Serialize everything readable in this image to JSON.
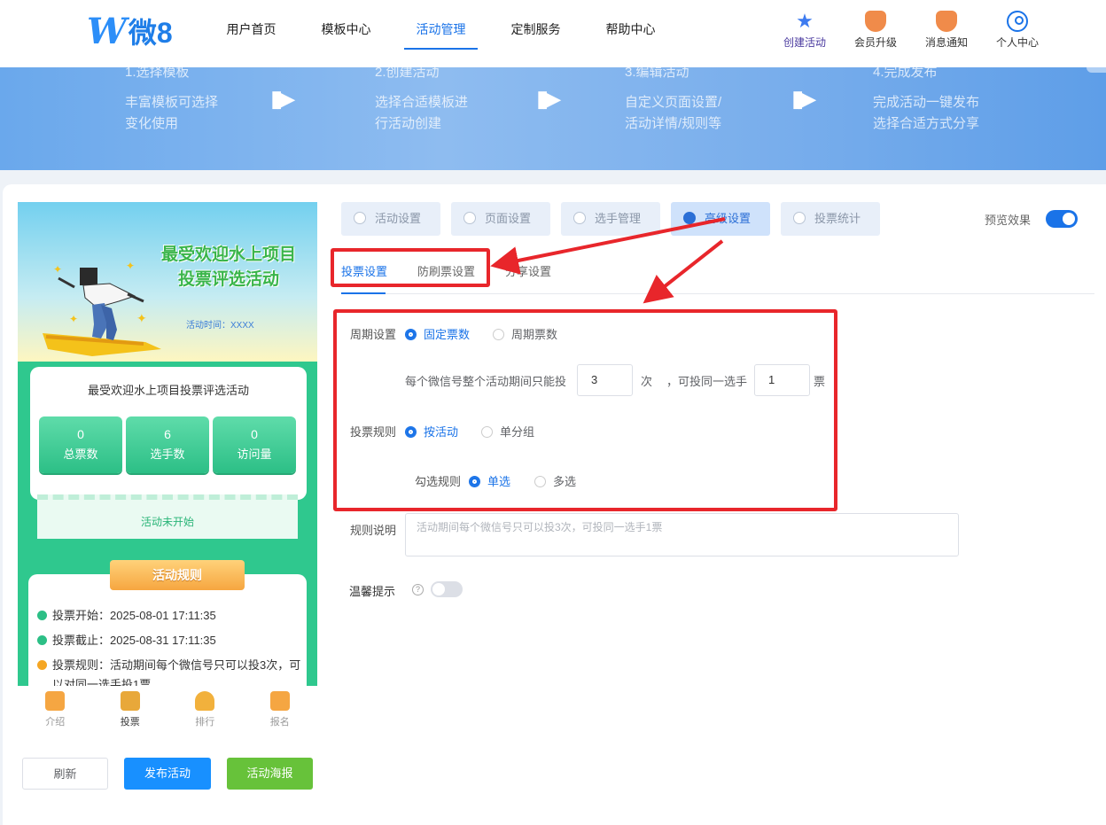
{
  "header": {
    "logo_text": "微8",
    "nav": [
      "用户首页",
      "模板中心",
      "活动管理",
      "定制服务",
      "帮助中心"
    ],
    "active_nav": 2,
    "actions": [
      {
        "label": "创建活动",
        "icon": "star-icon"
      },
      {
        "label": "会员升级",
        "icon": "crown-icon"
      },
      {
        "label": "消息通知",
        "icon": "bell-icon"
      },
      {
        "label": "个人中心",
        "icon": "user-icon"
      }
    ]
  },
  "steps": [
    {
      "title": "1.选择模板",
      "line1": "丰富模板可选择",
      "line2": "变化使用"
    },
    {
      "title": "2.创建活动",
      "line1": "选择合适模板进",
      "line2": "行活动创建"
    },
    {
      "title": "3.编辑活动",
      "line1": "自定义页面设置/",
      "line2": "活动详情/规则等"
    },
    {
      "title": "4.完成发布",
      "line1": "完成活动一键发布",
      "line2": "选择合适方式分享"
    }
  ],
  "preview": {
    "title_line1": "最受欢迎水上项目",
    "title_line2": "投票评选活动",
    "time_label": "活动时间：XXXX",
    "card_title": "最受欢迎水上项目投票评选活动",
    "stats": [
      {
        "value": "0",
        "label": "总票数"
      },
      {
        "value": "6",
        "label": "选手数"
      },
      {
        "value": "0",
        "label": "访问量"
      }
    ],
    "status": "活动未开始",
    "rules_title": "活动规则",
    "rule_start": "投票开始：2025-08-01 17:11:35",
    "rule_end": "投票截止：2025-08-31 17:11:35",
    "rule_text_1": "投票规则：活动期间每个微信号只可以投3次，可",
    "rule_text_2": "以对同一选手投1票",
    "bottom_nav": [
      "介绍",
      "投票",
      "排行",
      "报名"
    ],
    "buttons": {
      "refresh": "刷新",
      "publish": "发布活动",
      "poster": "活动海报"
    }
  },
  "tabs": [
    "活动设置",
    "页面设置",
    "选手管理",
    "高级设置",
    "投票统计"
  ],
  "active_tab": 3,
  "preview_toggle_label": "预览效果",
  "subtabs": [
    "投票设置",
    "防刷票设置",
    "分享设置"
  ],
  "form": {
    "period_label": "周期设置",
    "period_opt1": "固定票数",
    "period_opt2": "周期票数",
    "limit_text": "每个微信号整个活动期间只能投",
    "limit_value": "3",
    "limit_unit": "次",
    "per_text": "，可投同一选手",
    "per_value": "1",
    "per_unit": "票",
    "rule_label": "投票规则",
    "rule_opt1": "按活动",
    "rule_opt2": "单分组",
    "check_label": "勾选规则",
    "check_opt1": "单选",
    "check_opt2": "多选",
    "desc_label": "规则说明",
    "desc_placeholder": "活动期间每个微信号只可以投3次，可投同一选手1票",
    "tip_label": "温馨提示",
    "help_glyph": "?"
  },
  "colors": {
    "accent": "#1a73e8",
    "annotation": "#e8262b",
    "green": "#2cbf86"
  }
}
